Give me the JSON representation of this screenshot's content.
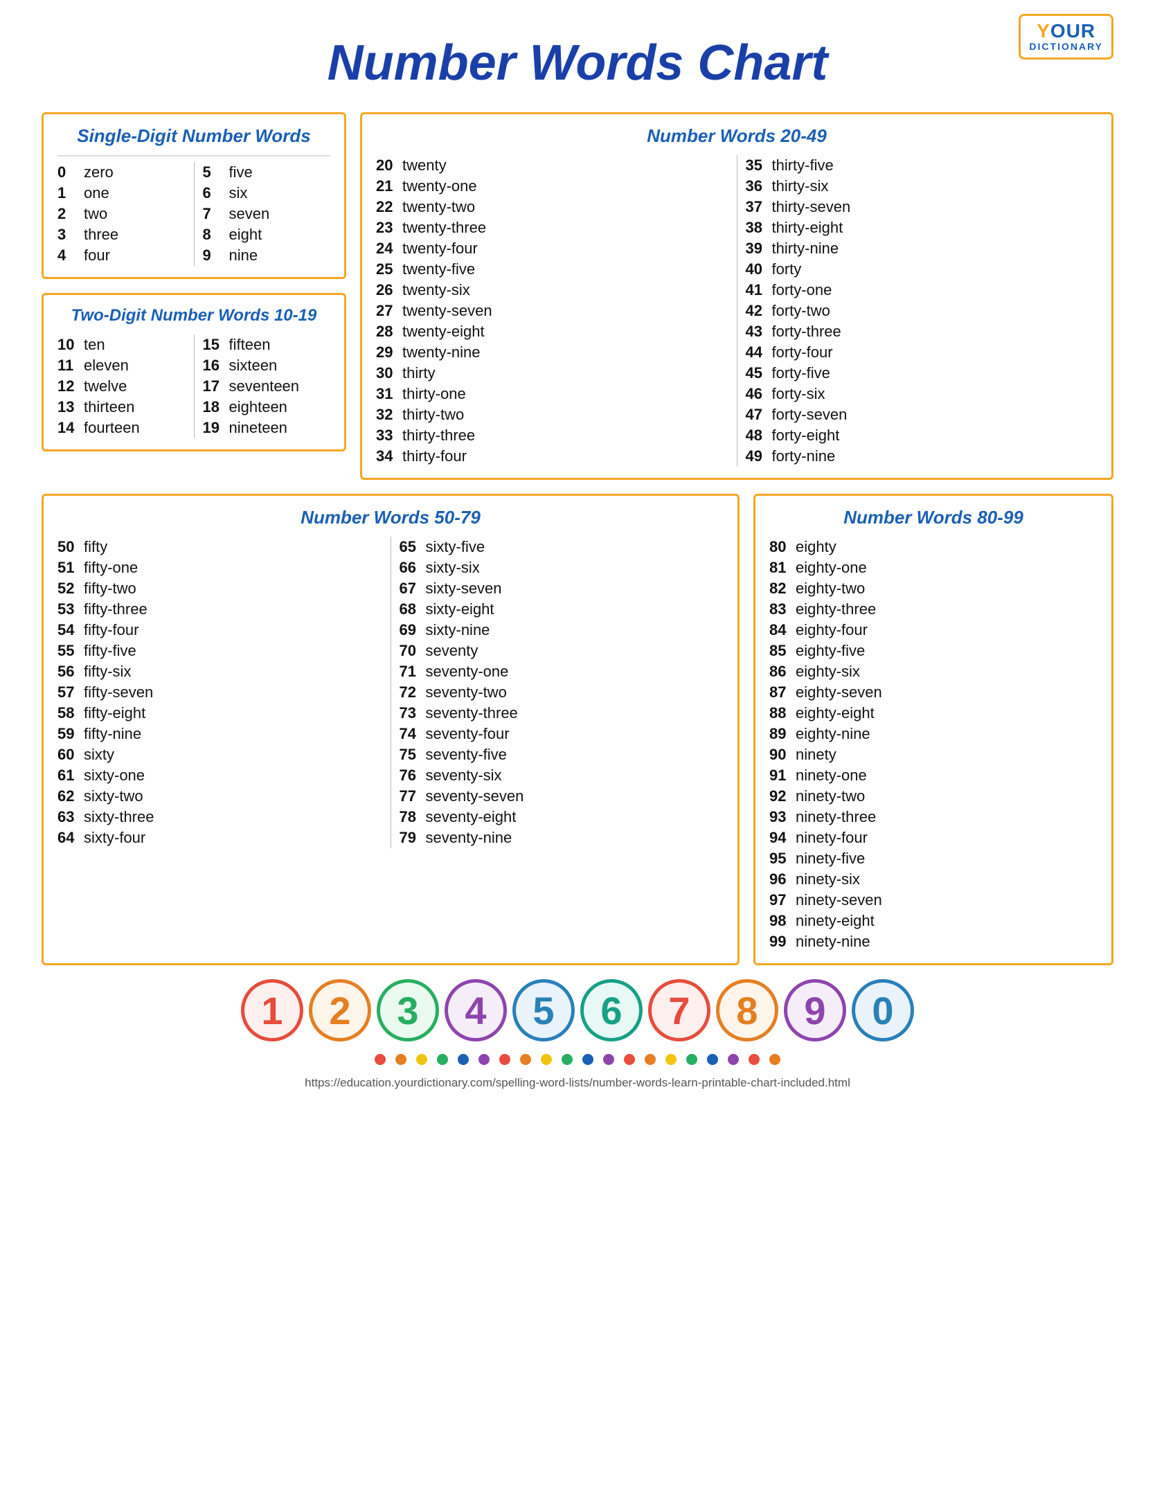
{
  "title": "Number Words Chart",
  "logo": {
    "your": "Y",
    "your_rest": "OUR",
    "dictionary": "DICTIONARY"
  },
  "url": "https://education.yourdictionary.com/spelling-word-lists/number-words-learn-printable-chart-included.html",
  "single_digit": {
    "title": "Single-Digit Number Words",
    "col1": [
      {
        "num": "0",
        "word": "zero"
      },
      {
        "num": "1",
        "word": "one"
      },
      {
        "num": "2",
        "word": "two"
      },
      {
        "num": "3",
        "word": "three"
      },
      {
        "num": "4",
        "word": "four"
      }
    ],
    "col2": [
      {
        "num": "5",
        "word": "five"
      },
      {
        "num": "6",
        "word": "six"
      },
      {
        "num": "7",
        "word": "seven"
      },
      {
        "num": "8",
        "word": "eight"
      },
      {
        "num": "9",
        "word": "nine"
      }
    ]
  },
  "two_digit": {
    "title": "Two-Digit Number Words 10-19",
    "col1": [
      {
        "num": "10",
        "word": "ten"
      },
      {
        "num": "11",
        "word": "eleven"
      },
      {
        "num": "12",
        "word": "twelve"
      },
      {
        "num": "13",
        "word": "thirteen"
      },
      {
        "num": "14",
        "word": "fourteen"
      }
    ],
    "col2": [
      {
        "num": "15",
        "word": "fifteen"
      },
      {
        "num": "16",
        "word": "sixteen"
      },
      {
        "num": "17",
        "word": "seventeen"
      },
      {
        "num": "18",
        "word": "eighteen"
      },
      {
        "num": "19",
        "word": "nineteen"
      }
    ]
  },
  "twenty_fortynine": {
    "title": "Number Words 20-49",
    "col1": [
      {
        "num": "20",
        "word": "twenty"
      },
      {
        "num": "21",
        "word": "twenty-one"
      },
      {
        "num": "22",
        "word": "twenty-two"
      },
      {
        "num": "23",
        "word": "twenty-three"
      },
      {
        "num": "24",
        "word": "twenty-four"
      },
      {
        "num": "25",
        "word": "twenty-five"
      },
      {
        "num": "26",
        "word": "twenty-six"
      },
      {
        "num": "27",
        "word": "twenty-seven"
      },
      {
        "num": "28",
        "word": "twenty-eight"
      },
      {
        "num": "29",
        "word": "twenty-nine"
      },
      {
        "num": "30",
        "word": "thirty"
      },
      {
        "num": "31",
        "word": "thirty-one"
      },
      {
        "num": "32",
        "word": "thirty-two"
      },
      {
        "num": "33",
        "word": "thirty-three"
      },
      {
        "num": "34",
        "word": "thirty-four"
      }
    ],
    "col2": [
      {
        "num": "35",
        "word": "thirty-five"
      },
      {
        "num": "36",
        "word": "thirty-six"
      },
      {
        "num": "37",
        "word": "thirty-seven"
      },
      {
        "num": "38",
        "word": "thirty-eight"
      },
      {
        "num": "39",
        "word": "thirty-nine"
      },
      {
        "num": "40",
        "word": "forty"
      },
      {
        "num": "41",
        "word": "forty-one"
      },
      {
        "num": "42",
        "word": "forty-two"
      },
      {
        "num": "43",
        "word": "forty-three"
      },
      {
        "num": "44",
        "word": "forty-four"
      },
      {
        "num": "45",
        "word": "forty-five"
      },
      {
        "num": "46",
        "word": "forty-six"
      },
      {
        "num": "47",
        "word": "forty-seven"
      },
      {
        "num": "48",
        "word": "forty-eight"
      },
      {
        "num": "49",
        "word": "forty-nine"
      }
    ]
  },
  "fifty_seventynine": {
    "title": "Number Words 50-79",
    "col1": [
      {
        "num": "50",
        "word": "fifty"
      },
      {
        "num": "51",
        "word": "fifty-one"
      },
      {
        "num": "52",
        "word": "fifty-two"
      },
      {
        "num": "53",
        "word": "fifty-three"
      },
      {
        "num": "54",
        "word": "fifty-four"
      },
      {
        "num": "55",
        "word": "fifty-five"
      },
      {
        "num": "56",
        "word": "fifty-six"
      },
      {
        "num": "57",
        "word": "fifty-seven"
      },
      {
        "num": "58",
        "word": "fifty-eight"
      },
      {
        "num": "59",
        "word": "fifty-nine"
      },
      {
        "num": "60",
        "word": "sixty"
      },
      {
        "num": "61",
        "word": "sixty-one"
      },
      {
        "num": "62",
        "word": "sixty-two"
      },
      {
        "num": "63",
        "word": "sixty-three"
      },
      {
        "num": "64",
        "word": "sixty-four"
      }
    ],
    "col2": [
      {
        "num": "65",
        "word": "sixty-five"
      },
      {
        "num": "66",
        "word": "sixty-six"
      },
      {
        "num": "67",
        "word": "sixty-seven"
      },
      {
        "num": "68",
        "word": "sixty-eight"
      },
      {
        "num": "69",
        "word": "sixty-nine"
      },
      {
        "num": "70",
        "word": "seventy"
      },
      {
        "num": "71",
        "word": "seventy-one"
      },
      {
        "num": "72",
        "word": "seventy-two"
      },
      {
        "num": "73",
        "word": "seventy-three"
      },
      {
        "num": "74",
        "word": "seventy-four"
      },
      {
        "num": "75",
        "word": "seventy-five"
      },
      {
        "num": "76",
        "word": "seventy-six"
      },
      {
        "num": "77",
        "word": "seventy-seven"
      },
      {
        "num": "78",
        "word": "seventy-eight"
      },
      {
        "num": "79",
        "word": "seventy-nine"
      }
    ]
  },
  "eighty_ninetynine": {
    "title": "Number Words 80-99",
    "col1": [
      {
        "num": "80",
        "word": "eighty"
      },
      {
        "num": "81",
        "word": "eighty-one"
      },
      {
        "num": "82",
        "word": "eighty-two"
      },
      {
        "num": "83",
        "word": "eighty-three"
      },
      {
        "num": "84",
        "word": "eighty-four"
      },
      {
        "num": "85",
        "word": "eighty-five"
      },
      {
        "num": "86",
        "word": "eighty-six"
      },
      {
        "num": "87",
        "word": "eighty-seven"
      },
      {
        "num": "88",
        "word": "eighty-eight"
      },
      {
        "num": "89",
        "word": "eighty-nine"
      },
      {
        "num": "90",
        "word": "ninety"
      },
      {
        "num": "91",
        "word": "ninety-one"
      },
      {
        "num": "92",
        "word": "ninety-two"
      },
      {
        "num": "93",
        "word": "ninety-three"
      },
      {
        "num": "94",
        "word": "ninety-four"
      },
      {
        "num": "95",
        "word": "ninety-five"
      },
      {
        "num": "96",
        "word": "ninety-six"
      },
      {
        "num": "97",
        "word": "ninety-seven"
      },
      {
        "num": "98",
        "word": "ninety-eight"
      },
      {
        "num": "99",
        "word": "ninety-nine"
      }
    ]
  },
  "deco_numbers": [
    "1",
    "2",
    "3",
    "4",
    "5",
    "6",
    "7",
    "8",
    "9",
    "0"
  ],
  "dots_count": 20,
  "colors": {
    "orange": "#f5a623",
    "blue": "#1a5fb4",
    "dark_blue": "#1a3fa8"
  }
}
